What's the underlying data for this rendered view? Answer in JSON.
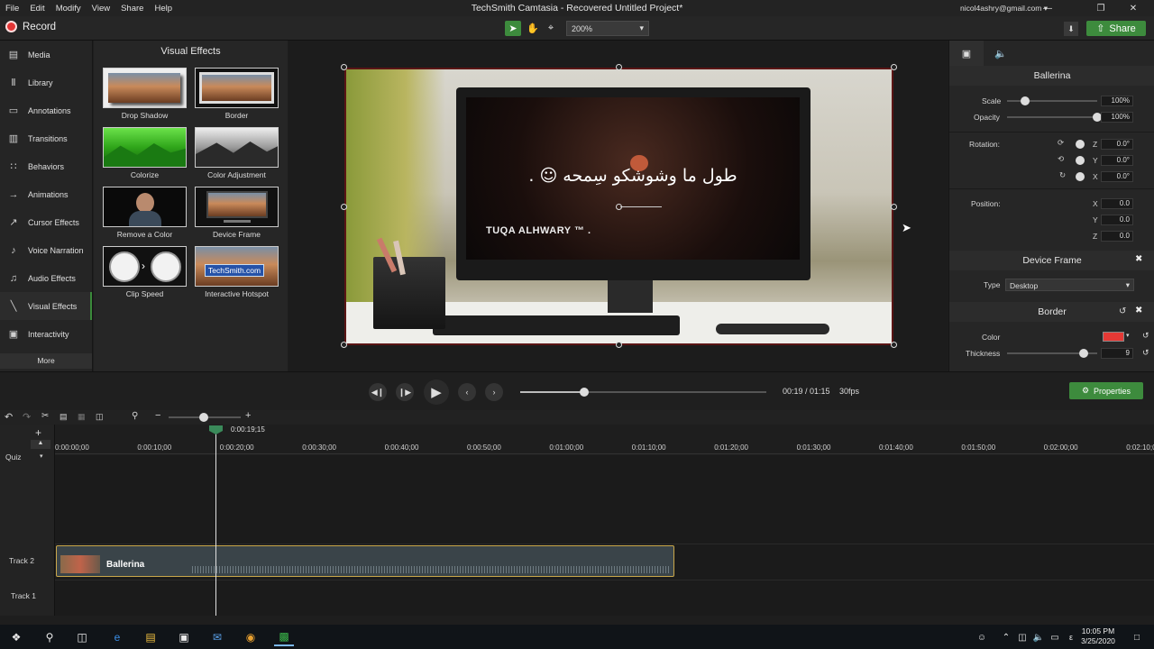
{
  "window": {
    "title": "TechSmith Camtasia - Recovered  Untitled Project*",
    "account": "nicol4ashry@gmail.com ▾"
  },
  "menu": [
    "File",
    "Edit",
    "Modify",
    "View",
    "Share",
    "Help"
  ],
  "toolbar": {
    "record_label": "Record",
    "zoom": "200%",
    "share_label": "Share"
  },
  "nav": {
    "items": [
      {
        "label": "Media",
        "icon": "▤"
      },
      {
        "label": "Library",
        "icon": "Ⅱ"
      },
      {
        "label": "Annotations",
        "icon": "▭"
      },
      {
        "label": "Transitions",
        "icon": "▥"
      },
      {
        "label": "Behaviors",
        "icon": "∷"
      },
      {
        "label": "Animations",
        "icon": "→"
      },
      {
        "label": "Cursor Effects",
        "icon": "↗"
      },
      {
        "label": "Voice Narration",
        "icon": "♪"
      },
      {
        "label": "Audio Effects",
        "icon": "♫"
      },
      {
        "label": "Visual Effects",
        "icon": "╲"
      },
      {
        "label": "Interactivity",
        "icon": "▣"
      }
    ],
    "more": "More"
  },
  "effects": {
    "title": "Visual Effects",
    "items": [
      "Drop Shadow",
      "Border",
      "Colorize",
      "Color Adjustment",
      "Remove a Color",
      "Device Frame",
      "Clip Speed",
      "Interactive Hotspot"
    ],
    "hotspot_text": "TechSmith.com"
  },
  "canvas": {
    "arabic_caption": "طول ما وشوشكو سِمحه ☺ .",
    "name_caption": "TUQA ALHWARY ™ ."
  },
  "props": {
    "clip_title": "Ballerina",
    "scale_label": "Scale",
    "scale": "100%",
    "opacity_label": "Opacity",
    "opacity": "100%",
    "rotation_label": "Rotation:",
    "rotation": [
      {
        "axis": "Z",
        "value": "0.0°"
      },
      {
        "axis": "Y",
        "value": "0.0°"
      },
      {
        "axis": "X",
        "value": "0.0°"
      }
    ],
    "position_label": "Position:",
    "position": [
      {
        "axis": "X",
        "value": "0.0"
      },
      {
        "axis": "Y",
        "value": "0.0"
      },
      {
        "axis": "Z",
        "value": "0.0"
      }
    ],
    "device_frame_title": "Device Frame",
    "type_label": "Type",
    "type_value": "Desktop",
    "border_title": "Border",
    "color_label": "Color",
    "color_value": "#e53935",
    "thickness_label": "Thickness",
    "thickness": "9",
    "scale_level": 0.2,
    "opacity_level": 1.0,
    "thickness_level": 0.85
  },
  "playback": {
    "time": "00:19 / 01:15",
    "fps": "30fps",
    "properties_label": "Properties",
    "progress": 0.26
  },
  "timeline": {
    "playhead_time": "0:00:19;15",
    "ticks": [
      "0:00:00;00",
      "0:00:10;00",
      "0:00:20;00",
      "0:00:30;00",
      "0:00:40;00",
      "0:00:50;00",
      "0:01:00;00",
      "0:01:10;00",
      "0:01:20;00",
      "0:01:30;00",
      "0:01:40;00",
      "0:01:50;00",
      "0:02:00;00",
      "0:02:10;00"
    ],
    "quiz_label": "Quiz",
    "tracks": [
      "Track 2",
      "Track 1"
    ],
    "clip_label": "Ballerina"
  },
  "taskbar": {
    "time": "10:05 PM",
    "date": "3/25/2020"
  }
}
